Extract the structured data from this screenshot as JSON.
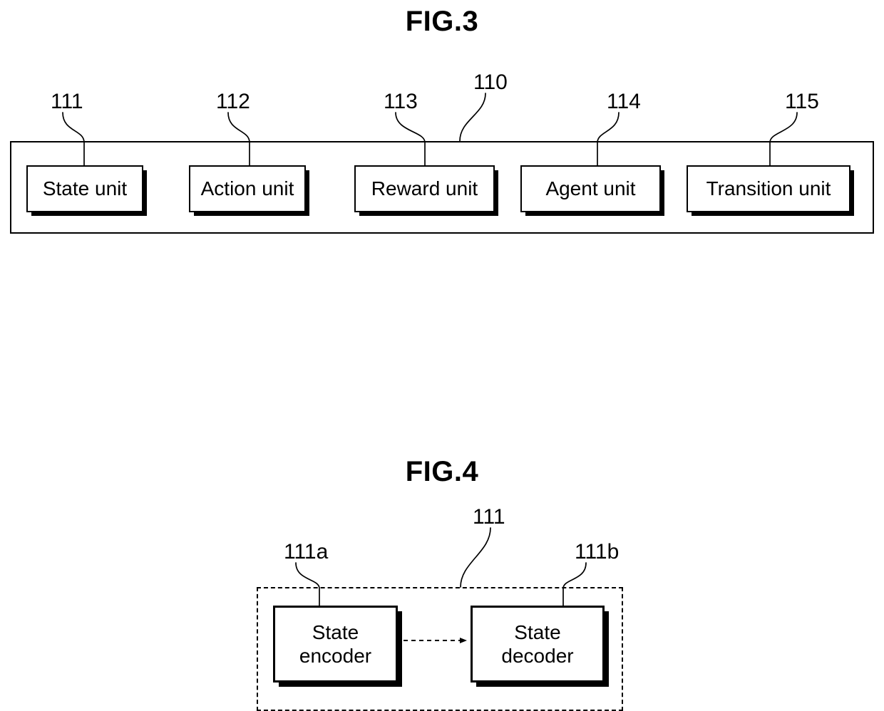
{
  "figures": [
    {
      "title": "FIG.3",
      "container_ref": "110",
      "blocks": [
        {
          "ref": "111",
          "label": "State unit"
        },
        {
          "ref": "112",
          "label": "Action unit"
        },
        {
          "ref": "113",
          "label": "Reward unit"
        },
        {
          "ref": "114",
          "label": "Agent unit"
        },
        {
          "ref": "115",
          "label": "Transition unit"
        }
      ]
    },
    {
      "title": "FIG.4",
      "container_ref": "111",
      "blocks": [
        {
          "ref": "111a",
          "label_line1": "State",
          "label_line2": "encoder"
        },
        {
          "ref": "111b",
          "label_line1": "State",
          "label_line2": "decoder"
        }
      ],
      "connector": "dashed-arrow-right"
    }
  ],
  "fig3": {
    "title": "FIG.3",
    "container_ref": "110",
    "refs": {
      "state": "111",
      "action": "112",
      "reward": "113",
      "agent": "114",
      "transition": "115",
      "container": "110"
    },
    "labels": {
      "state": "State unit",
      "action": "Action unit",
      "reward": "Reward unit",
      "agent": "Agent unit",
      "transition": "Transition unit"
    }
  },
  "fig4": {
    "title": "FIG.4",
    "refs": {
      "container": "111",
      "encoder": "111a",
      "decoder": "111b"
    },
    "labels": {
      "encoder_line1": "State",
      "encoder_line2": "encoder",
      "decoder_line1": "State",
      "decoder_line2": "decoder"
    }
  },
  "colors": {
    "ink": "#000000",
    "paper": "#ffffff"
  }
}
